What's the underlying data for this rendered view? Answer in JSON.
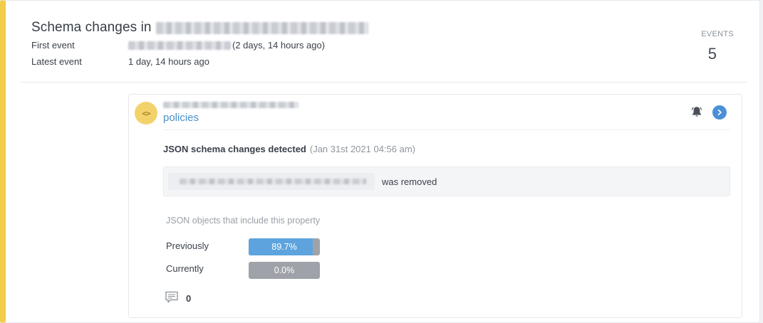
{
  "header": {
    "title": "Schema changes in",
    "first_event_label": "First event",
    "first_event_relative": "(2 days, 14 hours ago)",
    "latest_event_label": "Latest event",
    "latest_event_value": "1 day, 14 hours ago",
    "events_label": "EVENTS",
    "events_count": "5"
  },
  "item": {
    "badge_icon": "code-brackets-icon",
    "badge_text": "<>",
    "property_name": "policies",
    "change_title": "JSON schema changes detected",
    "change_time": "(Jan 31st 2021 04:56 am)",
    "removed_text": "was removed",
    "objects_label": "JSON objects that include this property",
    "previously_label": "Previously",
    "previously_value": "89.7%",
    "previously_fraction": 0.897,
    "currently_label": "Currently",
    "currently_value": "0.0%",
    "currently_fraction": 0.0,
    "comment_count": "0"
  },
  "colors": {
    "accent_border": "#f2cc4a",
    "link": "#4a8fc9",
    "bar_fill": "#5da4de",
    "bar_empty": "#9fa2a8",
    "go_button": "#4a90d9"
  }
}
